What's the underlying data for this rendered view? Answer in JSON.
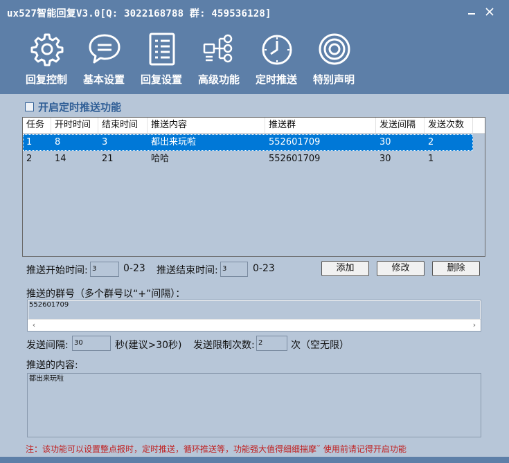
{
  "window": {
    "title": "ux527智能回复V3.0[Q: 3022168788 群: 459536128]",
    "minimize_glyph": "—",
    "close_glyph": "✕"
  },
  "toolbar": [
    {
      "label": "回复控制",
      "icon": "gear-icon"
    },
    {
      "label": "基本设置",
      "icon": "chat-bubble-icon"
    },
    {
      "label": "回复设置",
      "icon": "list-icon"
    },
    {
      "label": "高级功能",
      "icon": "network-icon"
    },
    {
      "label": "定时推送",
      "icon": "clock-icon"
    },
    {
      "label": "特别声明",
      "icon": "target-icon"
    }
  ],
  "schedule": {
    "enable_label": "开启定时推送功能",
    "enabled": false,
    "columns": [
      "任务",
      "开时时间",
      "结束时间",
      "推送内容",
      "推送群",
      "发送间隔",
      "发送次数"
    ],
    "rows": [
      [
        "1",
        "8",
        "3",
        "都出来玩啦",
        "552601709",
        "30",
        "2"
      ],
      [
        "2",
        "14",
        "21",
        "哈哈",
        "552601709",
        "30",
        "1"
      ]
    ],
    "selected_row": 0
  },
  "form": {
    "start_label": "推送开始时间:",
    "start_value": "3",
    "start_range": "0-23",
    "end_label": "推送结束时间:",
    "end_value": "3",
    "end_range": "0-23",
    "add_button": "添加",
    "edit_button": "修改",
    "delete_button": "删除",
    "groups_label": "推送的群号（多个群号以“+”间隔）：",
    "groups_value": "552601709",
    "interval_label": "发送间隔:",
    "interval_value": "30",
    "interval_suffix": "秒(建议>30秒)",
    "limit_label": "发送限制次数:",
    "limit_value": "2",
    "limit_suffix": "次（空无限）",
    "content_label": "推送的内容:",
    "content_value": "都出来玩啦"
  },
  "note": "注：该功能可以设置整点报时，定时推送，循环推送等，功能强大值得细细揣摩˘ 使用前请记得开启功能",
  "colors": {
    "header": "#5d7fa8",
    "body": "#b7c6d8",
    "selected": "#0078d7",
    "accent_text": "#2f5e96",
    "note": "#c02020"
  }
}
